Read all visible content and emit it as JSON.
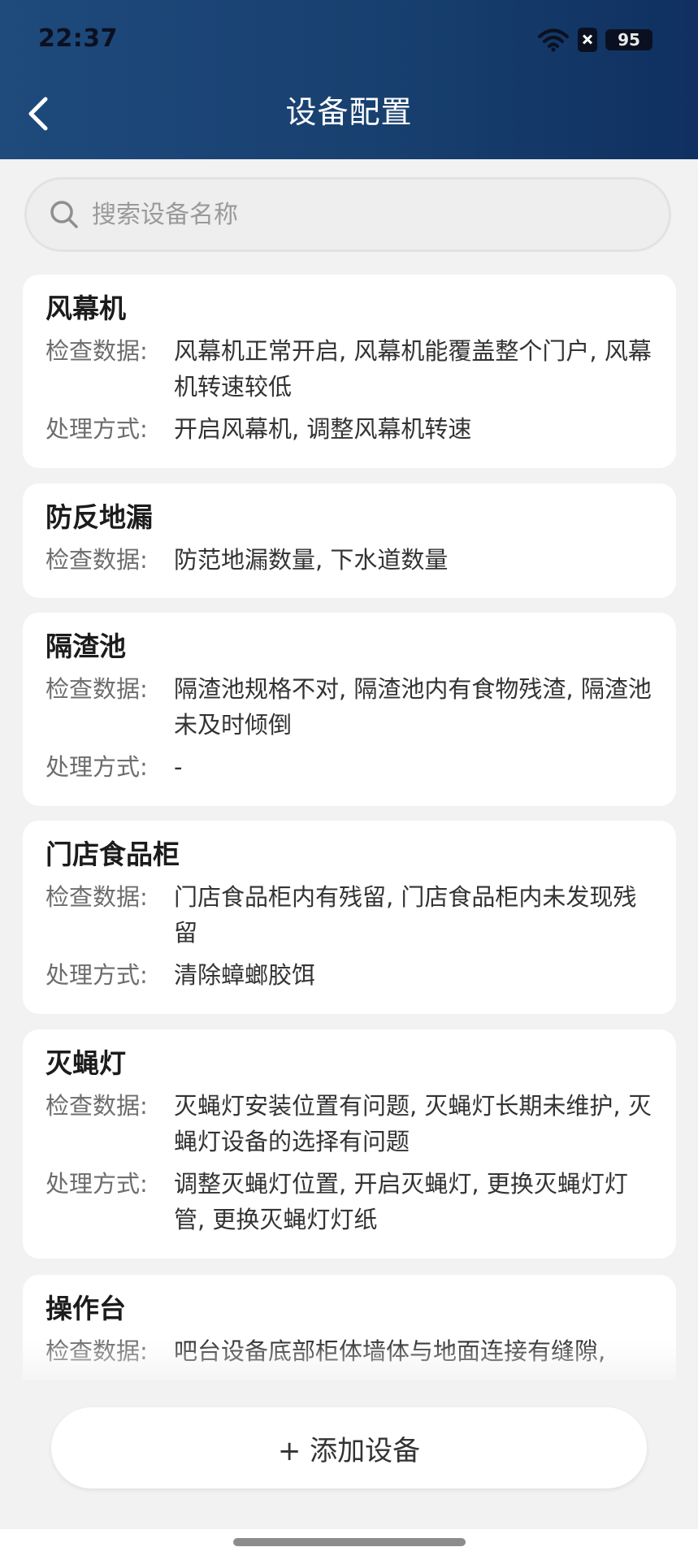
{
  "status_bar": {
    "time": "22:37",
    "battery": "95"
  },
  "header": {
    "title": "设备配置"
  },
  "search": {
    "placeholder": "搜索设备名称",
    "value": ""
  },
  "labels": {
    "check_data": "检查数据:",
    "handling": "处理方式:"
  },
  "devices": [
    {
      "name": "风幕机",
      "check_data": "风幕机正常开启, 风幕机能覆盖整个门户, 风幕机转速较低",
      "handling": "开启风幕机, 调整风幕机转速"
    },
    {
      "name": "防反地漏",
      "check_data": "防范地漏数量, 下水道数量"
    },
    {
      "name": "隔渣池",
      "check_data": "隔渣池规格不对, 隔渣池内有食物残渣, 隔渣池未及时倾倒",
      "handling": "-"
    },
    {
      "name": "门店食品柜",
      "check_data": "门店食品柜内有残留, 门店食品柜内未发现残留",
      "handling": "清除蟑螂胶饵"
    },
    {
      "name": "灭蝇灯",
      "check_data": "灭蝇灯安装位置有问题, 灭蝇灯长期未维护, 灭蝇灯设备的选择有问题",
      "handling": "调整灭蝇灯位置, 开启灭蝇灯, 更换灭蝇灯灯管, 更换灭蝇灯灯纸"
    },
    {
      "name": "操作台",
      "check_data": "吧台设备底部柜体墙体与地面连接有缝隙,"
    }
  ],
  "footer": {
    "add_button": "+ 添加设备"
  }
}
